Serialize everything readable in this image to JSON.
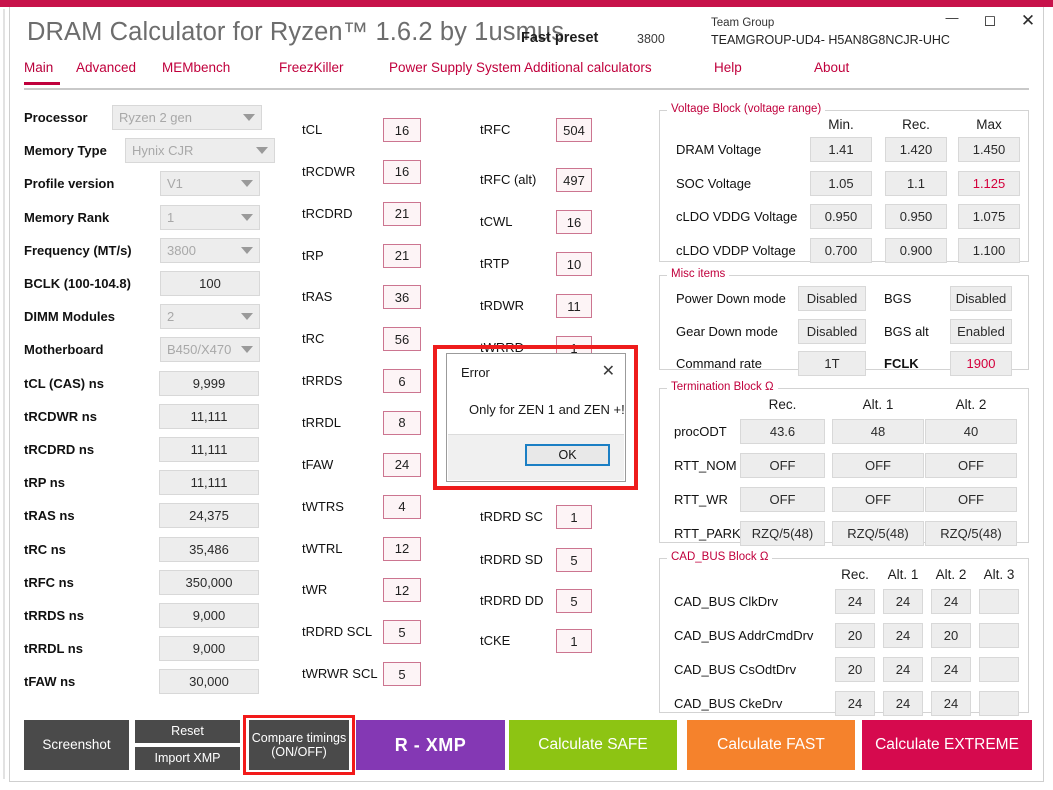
{
  "window": {
    "minimize": "—",
    "maximize": "◻",
    "close": "✕"
  },
  "header": {
    "title": "DRAM Calculator for Ryzen™ 1.6.2 by 1usmus",
    "preset_label": "Fast preset",
    "preset_value": "3800",
    "memory_brand": "Team Group",
    "memory_part": "TEAMGROUP-UD4- H5AN8G8NCJR-UHC"
  },
  "tabs": [
    {
      "label": "Main",
      "active": true
    },
    {
      "label": "Advanced",
      "active": false
    },
    {
      "label": "MEMbench",
      "active": false
    },
    {
      "label": "FreezKiller",
      "active": false
    },
    {
      "label": "Power Supply System",
      "active": false
    },
    {
      "label": "Additional calculators",
      "active": false
    },
    {
      "label": "Help",
      "active": false
    },
    {
      "label": "About",
      "active": false
    }
  ],
  "left_panel": {
    "combos": [
      {
        "label": "Processor",
        "value": "Ryzen 2 gen"
      },
      {
        "label": "Memory Type",
        "value": "Hynix CJR"
      },
      {
        "label": "Profile version",
        "value": "V1"
      },
      {
        "label": "Memory Rank",
        "value": "1"
      },
      {
        "label": "Frequency (MT/s)",
        "value": "3800"
      }
    ],
    "bclk": {
      "label": "BCLK (100-104.8)",
      "value": "100"
    },
    "combos2": [
      {
        "label": "DIMM Modules",
        "value": "2"
      },
      {
        "label": "Motherboard",
        "value": "B450/X470"
      }
    ],
    "ns_values": [
      {
        "label": "tCL (CAS) ns",
        "value": "9,999"
      },
      {
        "label": "tRCDWR ns",
        "value": "11,111"
      },
      {
        "label": "tRCDRD ns",
        "value": "11,111"
      },
      {
        "label": "tRP ns",
        "value": "11,111"
      },
      {
        "label": "tRAS ns",
        "value": "24,375"
      },
      {
        "label": "tRC ns",
        "value": "35,486"
      },
      {
        "label": "tRFC ns",
        "value": "350,000"
      },
      {
        "label": "tRRDS ns",
        "value": "9,000"
      },
      {
        "label": "tRRDL ns",
        "value": "9,000"
      },
      {
        "label": "tFAW ns",
        "value": "30,000"
      }
    ]
  },
  "timings_col1": [
    {
      "label": "tCL",
      "value": "16"
    },
    {
      "label": "tRCDWR",
      "value": "16"
    },
    {
      "label": "tRCDRD",
      "value": "21"
    },
    {
      "label": "tRP",
      "value": "21"
    },
    {
      "label": "tRAS",
      "value": "36"
    },
    {
      "label": "tRC",
      "value": "56"
    },
    {
      "label": "tRRDS",
      "value": "6"
    },
    {
      "label": "tRRDL",
      "value": "8"
    },
    {
      "label": "tFAW",
      "value": "24"
    },
    {
      "label": "tWTRS",
      "value": "4"
    },
    {
      "label": "tWTRL",
      "value": "12"
    },
    {
      "label": "tWR",
      "value": "12"
    },
    {
      "label": "tRDRD SCL",
      "value": "5"
    },
    {
      "label": "tWRWR SCL",
      "value": "5"
    }
  ],
  "timings_col2": [
    {
      "label": "tRFC",
      "value": "504"
    },
    {
      "label": "tRFC (alt)",
      "value": "497"
    },
    {
      "label": "tCWL",
      "value": "16"
    },
    {
      "label": "tRTP",
      "value": "10"
    },
    {
      "label": "tRDWR",
      "value": "11"
    },
    {
      "label": "tWRRD",
      "value": "1"
    },
    {
      "label": "tRDRD SC",
      "value": "1"
    },
    {
      "label": "tRDRD SD",
      "value": "5"
    },
    {
      "label": "tRDRD DD",
      "value": "5"
    },
    {
      "label": "tCKE",
      "value": "1"
    }
  ],
  "voltage_block": {
    "title": "Voltage Block (voltage range)",
    "columns": [
      "Min.",
      "Rec.",
      "Max"
    ],
    "rows": [
      {
        "label": "DRAM Voltage",
        "values": [
          "1.41",
          "1.420",
          "1.450"
        ],
        "highlight": [
          false,
          false,
          false
        ]
      },
      {
        "label": "SOC Voltage",
        "values": [
          "1.05",
          "1.1",
          "1.125"
        ],
        "highlight": [
          false,
          false,
          true
        ]
      },
      {
        "label": "cLDO VDDG Voltage",
        "values": [
          "0.950",
          "0.950",
          "1.075"
        ],
        "highlight": [
          false,
          false,
          false
        ]
      },
      {
        "label": "cLDO VDDP Voltage",
        "values": [
          "0.700",
          "0.900",
          "1.100"
        ],
        "highlight": [
          false,
          false,
          false
        ]
      }
    ]
  },
  "misc_items": {
    "title": "Misc items",
    "rows": [
      {
        "label_left": "Power Down mode",
        "value_left": "Disabled",
        "label_right": "BGS",
        "value_right": "Disabled",
        "bold_right": false,
        "red_right": false
      },
      {
        "label_left": "Gear Down mode",
        "value_left": "Disabled",
        "label_right": "BGS alt",
        "value_right": "Enabled",
        "bold_right": false,
        "red_right": false
      },
      {
        "label_left": "Command rate",
        "value_left": "1T",
        "label_right": "FCLK",
        "value_right": "1900",
        "bold_right": true,
        "red_right": true
      }
    ]
  },
  "termination_block": {
    "title": "Termination Block Ω",
    "columns": [
      "Rec.",
      "Alt. 1",
      "Alt. 2"
    ],
    "rows": [
      {
        "label": "procODT",
        "values": [
          "43.6",
          "48",
          "40"
        ]
      },
      {
        "label": "RTT_NOM",
        "values": [
          "OFF",
          "OFF",
          "OFF"
        ]
      },
      {
        "label": "RTT_WR",
        "values": [
          "OFF",
          "OFF",
          "OFF"
        ]
      },
      {
        "label": "RTT_PARK",
        "values": [
          "RZQ/5(48)",
          "RZQ/5(48)",
          "RZQ/5(48)"
        ]
      }
    ]
  },
  "cad_bus_block": {
    "title": "CAD_BUS Block Ω",
    "columns": [
      "Rec.",
      "Alt. 1",
      "Alt. 2",
      "Alt. 3"
    ],
    "rows": [
      {
        "label": "CAD_BUS ClkDrv",
        "values": [
          "24",
          "24",
          "24",
          ""
        ]
      },
      {
        "label": "CAD_BUS AddrCmdDrv",
        "values": [
          "20",
          "24",
          "20",
          ""
        ]
      },
      {
        "label": "CAD_BUS CsOdtDrv",
        "values": [
          "20",
          "24",
          "24",
          ""
        ]
      },
      {
        "label": "CAD_BUS CkeDrv",
        "values": [
          "24",
          "24",
          "24",
          ""
        ]
      }
    ]
  },
  "error_dialog": {
    "title": "Error",
    "close": "✕",
    "message": "Only for ZEN 1 and ZEN +!",
    "ok_label": "OK"
  },
  "bottom_buttons": {
    "screenshot": "Screenshot",
    "reset": "Reset",
    "import_xmp": "Import XMP",
    "compare_line1": "Compare timings",
    "compare_line2": "(ON/OFF)",
    "r_xmp": "R - XMP",
    "calc_safe": "Calculate SAFE",
    "calc_fast": "Calculate FAST",
    "calc_extreme": "Calculate EXTREME"
  },
  "colors": {
    "brand": "#c0003c",
    "accent_strip": "#c7124a",
    "purple": "#8438b4",
    "green": "#8dc413",
    "orange": "#f5822c",
    "crimson": "#d60a4e",
    "highlight_red": "#ee1c1c",
    "dark_button": "#4a4a4a"
  }
}
